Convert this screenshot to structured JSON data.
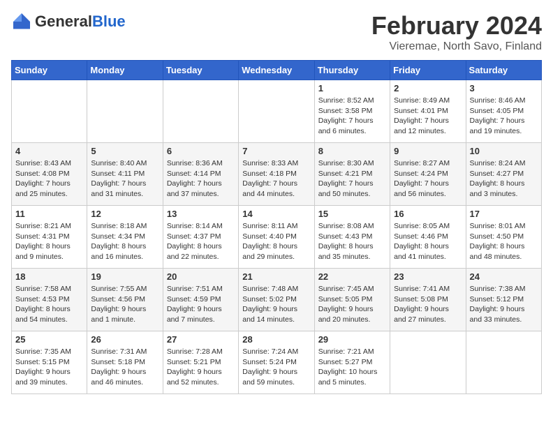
{
  "header": {
    "logo_general": "General",
    "logo_blue": "Blue",
    "month": "February 2024",
    "location": "Vieremae, North Savo, Finland"
  },
  "weekdays": [
    "Sunday",
    "Monday",
    "Tuesday",
    "Wednesday",
    "Thursday",
    "Friday",
    "Saturday"
  ],
  "weeks": [
    [
      {
        "day": "",
        "sunrise": "",
        "sunset": "",
        "daylight": ""
      },
      {
        "day": "",
        "sunrise": "",
        "sunset": "",
        "daylight": ""
      },
      {
        "day": "",
        "sunrise": "",
        "sunset": "",
        "daylight": ""
      },
      {
        "day": "",
        "sunrise": "",
        "sunset": "",
        "daylight": ""
      },
      {
        "day": "1",
        "sunrise": "Sunrise: 8:52 AM",
        "sunset": "Sunset: 3:58 PM",
        "daylight": "Daylight: 7 hours and 6 minutes."
      },
      {
        "day": "2",
        "sunrise": "Sunrise: 8:49 AM",
        "sunset": "Sunset: 4:01 PM",
        "daylight": "Daylight: 7 hours and 12 minutes."
      },
      {
        "day": "3",
        "sunrise": "Sunrise: 8:46 AM",
        "sunset": "Sunset: 4:05 PM",
        "daylight": "Daylight: 7 hours and 19 minutes."
      }
    ],
    [
      {
        "day": "4",
        "sunrise": "Sunrise: 8:43 AM",
        "sunset": "Sunset: 4:08 PM",
        "daylight": "Daylight: 7 hours and 25 minutes."
      },
      {
        "day": "5",
        "sunrise": "Sunrise: 8:40 AM",
        "sunset": "Sunset: 4:11 PM",
        "daylight": "Daylight: 7 hours and 31 minutes."
      },
      {
        "day": "6",
        "sunrise": "Sunrise: 8:36 AM",
        "sunset": "Sunset: 4:14 PM",
        "daylight": "Daylight: 7 hours and 37 minutes."
      },
      {
        "day": "7",
        "sunrise": "Sunrise: 8:33 AM",
        "sunset": "Sunset: 4:18 PM",
        "daylight": "Daylight: 7 hours and 44 minutes."
      },
      {
        "day": "8",
        "sunrise": "Sunrise: 8:30 AM",
        "sunset": "Sunset: 4:21 PM",
        "daylight": "Daylight: 7 hours and 50 minutes."
      },
      {
        "day": "9",
        "sunrise": "Sunrise: 8:27 AM",
        "sunset": "Sunset: 4:24 PM",
        "daylight": "Daylight: 7 hours and 56 minutes."
      },
      {
        "day": "10",
        "sunrise": "Sunrise: 8:24 AM",
        "sunset": "Sunset: 4:27 PM",
        "daylight": "Daylight: 8 hours and 3 minutes."
      }
    ],
    [
      {
        "day": "11",
        "sunrise": "Sunrise: 8:21 AM",
        "sunset": "Sunset: 4:31 PM",
        "daylight": "Daylight: 8 hours and 9 minutes."
      },
      {
        "day": "12",
        "sunrise": "Sunrise: 8:18 AM",
        "sunset": "Sunset: 4:34 PM",
        "daylight": "Daylight: 8 hours and 16 minutes."
      },
      {
        "day": "13",
        "sunrise": "Sunrise: 8:14 AM",
        "sunset": "Sunset: 4:37 PM",
        "daylight": "Daylight: 8 hours and 22 minutes."
      },
      {
        "day": "14",
        "sunrise": "Sunrise: 8:11 AM",
        "sunset": "Sunset: 4:40 PM",
        "daylight": "Daylight: 8 hours and 29 minutes."
      },
      {
        "day": "15",
        "sunrise": "Sunrise: 8:08 AM",
        "sunset": "Sunset: 4:43 PM",
        "daylight": "Daylight: 8 hours and 35 minutes."
      },
      {
        "day": "16",
        "sunrise": "Sunrise: 8:05 AM",
        "sunset": "Sunset: 4:46 PM",
        "daylight": "Daylight: 8 hours and 41 minutes."
      },
      {
        "day": "17",
        "sunrise": "Sunrise: 8:01 AM",
        "sunset": "Sunset: 4:50 PM",
        "daylight": "Daylight: 8 hours and 48 minutes."
      }
    ],
    [
      {
        "day": "18",
        "sunrise": "Sunrise: 7:58 AM",
        "sunset": "Sunset: 4:53 PM",
        "daylight": "Daylight: 8 hours and 54 minutes."
      },
      {
        "day": "19",
        "sunrise": "Sunrise: 7:55 AM",
        "sunset": "Sunset: 4:56 PM",
        "daylight": "Daylight: 9 hours and 1 minute."
      },
      {
        "day": "20",
        "sunrise": "Sunrise: 7:51 AM",
        "sunset": "Sunset: 4:59 PM",
        "daylight": "Daylight: 9 hours and 7 minutes."
      },
      {
        "day": "21",
        "sunrise": "Sunrise: 7:48 AM",
        "sunset": "Sunset: 5:02 PM",
        "daylight": "Daylight: 9 hours and 14 minutes."
      },
      {
        "day": "22",
        "sunrise": "Sunrise: 7:45 AM",
        "sunset": "Sunset: 5:05 PM",
        "daylight": "Daylight: 9 hours and 20 minutes."
      },
      {
        "day": "23",
        "sunrise": "Sunrise: 7:41 AM",
        "sunset": "Sunset: 5:08 PM",
        "daylight": "Daylight: 9 hours and 27 minutes."
      },
      {
        "day": "24",
        "sunrise": "Sunrise: 7:38 AM",
        "sunset": "Sunset: 5:12 PM",
        "daylight": "Daylight: 9 hours and 33 minutes."
      }
    ],
    [
      {
        "day": "25",
        "sunrise": "Sunrise: 7:35 AM",
        "sunset": "Sunset: 5:15 PM",
        "daylight": "Daylight: 9 hours and 39 minutes."
      },
      {
        "day": "26",
        "sunrise": "Sunrise: 7:31 AM",
        "sunset": "Sunset: 5:18 PM",
        "daylight": "Daylight: 9 hours and 46 minutes."
      },
      {
        "day": "27",
        "sunrise": "Sunrise: 7:28 AM",
        "sunset": "Sunset: 5:21 PM",
        "daylight": "Daylight: 9 hours and 52 minutes."
      },
      {
        "day": "28",
        "sunrise": "Sunrise: 7:24 AM",
        "sunset": "Sunset: 5:24 PM",
        "daylight": "Daylight: 9 hours and 59 minutes."
      },
      {
        "day": "29",
        "sunrise": "Sunrise: 7:21 AM",
        "sunset": "Sunset: 5:27 PM",
        "daylight": "Daylight: 10 hours and 5 minutes."
      },
      {
        "day": "",
        "sunrise": "",
        "sunset": "",
        "daylight": ""
      },
      {
        "day": "",
        "sunrise": "",
        "sunset": "",
        "daylight": ""
      }
    ]
  ]
}
